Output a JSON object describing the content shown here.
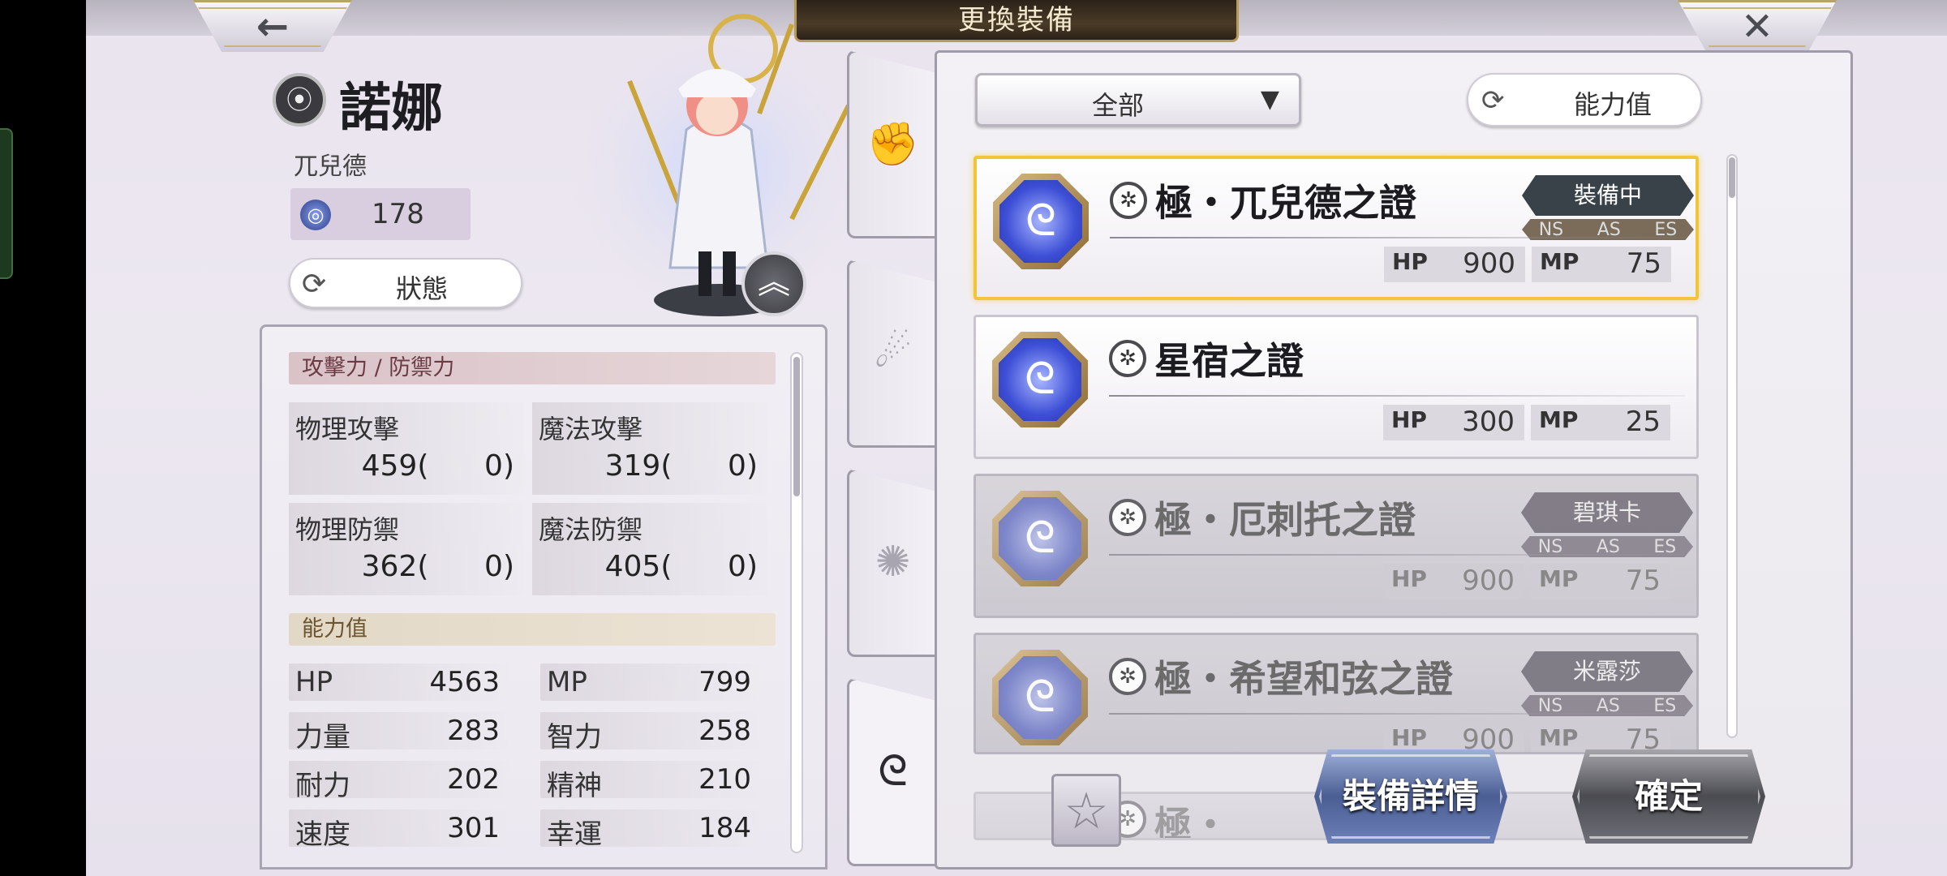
{
  "header": {
    "title": "更換裝備",
    "back_icon": "←",
    "close_icon": "✕"
  },
  "character": {
    "name": "諾娜",
    "class": "兀兒德",
    "power": "178",
    "status_button": "狀態",
    "class_icon": "⦿",
    "expand_icon": "︽"
  },
  "stats": {
    "atk_def_header": "攻擊力 / 防禦力",
    "atk_def": [
      {
        "label": "物理攻擊",
        "value": "459(      0)"
      },
      {
        "label": "魔法攻擊",
        "value": "319(      0)"
      },
      {
        "label": "物理防禦",
        "value": "362(      0)"
      },
      {
        "label": "魔法防禦",
        "value": "405(      0)"
      }
    ],
    "ability_header": "能力值",
    "ability": [
      {
        "label": "HP",
        "value": "4563"
      },
      {
        "label": "MP",
        "value": "799"
      },
      {
        "label": "力量",
        "value": "283"
      },
      {
        "label": "智力",
        "value": "258"
      },
      {
        "label": "耐力",
        "value": "202"
      },
      {
        "label": "精神",
        "value": "210"
      },
      {
        "label": "速度",
        "value": "301"
      },
      {
        "label": "幸運",
        "value": "184"
      }
    ]
  },
  "tabs": [
    {
      "icon": "✊",
      "name": "fist"
    },
    {
      "icon": "☄",
      "name": "swirl"
    },
    {
      "icon": "✺",
      "name": "star-burst"
    },
    {
      "icon": "ᘓ",
      "name": "orb"
    }
  ],
  "filter": {
    "label": "全部",
    "dropdown_icon": "▼",
    "sort_label": "能力值",
    "sort_icon": "⟳"
  },
  "items": [
    {
      "name": "極・兀兒德之證",
      "hp": "900",
      "mp": "75",
      "badge": "裝備中",
      "tags": [
        "NS",
        "AS",
        "ES"
      ],
      "state": "selected"
    },
    {
      "name": "星宿之證",
      "hp": "300",
      "mp": "25",
      "badge": "",
      "tags": [],
      "state": "normal"
    },
    {
      "name": "極・厄刺托之證",
      "hp": "900",
      "mp": "75",
      "badge": "碧琪卡",
      "tags": [
        "NS",
        "AS",
        "ES"
      ],
      "state": "dim"
    },
    {
      "name": "極・希望和弦之證",
      "hp": "900",
      "mp": "75",
      "badge": "米露莎",
      "tags": [
        "NS",
        "AS",
        "ES"
      ],
      "state": "dim"
    },
    {
      "name": "極・",
      "hp": "",
      "mp": "",
      "badge": "",
      "tags": [],
      "state": "dim"
    }
  ],
  "labels": {
    "hp": "HP",
    "mp": "MP"
  },
  "buttons": {
    "detail": "裝備詳情",
    "confirm": "確定",
    "star_icon": "☆"
  },
  "colors": {
    "selected_border": "#f2c43a",
    "equipped_badge": "#394248",
    "detail_button": "#4b5e94",
    "confirm_button": "#4b4b52"
  }
}
